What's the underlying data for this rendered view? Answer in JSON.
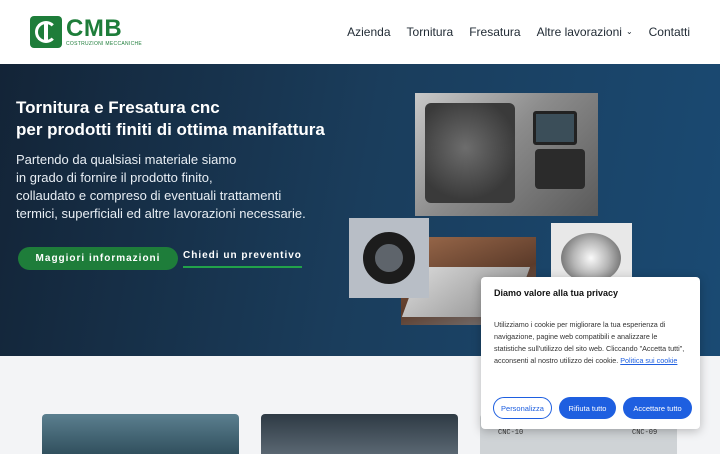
{
  "header": {
    "logo_name": "CMB",
    "logo_subtitle": "COSTRUZIONI MECCANICHE",
    "nav": [
      {
        "label": "Azienda"
      },
      {
        "label": "Tornitura"
      },
      {
        "label": "Fresatura"
      },
      {
        "label": "Altre lavorazioni",
        "has_dropdown": true
      },
      {
        "label": "Contatti"
      }
    ],
    "brand_color": "#1e7d3a"
  },
  "hero": {
    "title_line1": "Tornitura e Fresatura cnc",
    "title_line2": "per prodotti finiti di ottima manifattura",
    "text_lines": [
      "Partendo da qualsiasi materiale siamo",
      "in grado di fornire il prodotto finito,",
      "collaudato e compreso di eventuali trattamenti",
      "termici, superficiali ed altre lavorazioni necessarie."
    ],
    "primary_button": "Maggiori informazioni",
    "secondary_link": "Chiedi un preventivo"
  },
  "cards": {
    "card3_label_left": "CNC-10",
    "card3_label_right": "CNC-09"
  },
  "cookie": {
    "title": "Diamo valore alla tua privacy",
    "text": "Utilizziamo i cookie per migliorare la tua esperienza di navigazione, pagine web compatibili e analizzare le statistiche sull'utilizzo del sito web. Cliccando \"Accetta tutti\", acconsenti al nostro utilizzo dei cookie.",
    "policy_link": "Politica sui cookie",
    "buttons": {
      "customize": "Personalizza",
      "reject": "Rifiuta tutto",
      "accept": "Accettare tutto"
    },
    "accent_color": "#1e5fe0"
  }
}
